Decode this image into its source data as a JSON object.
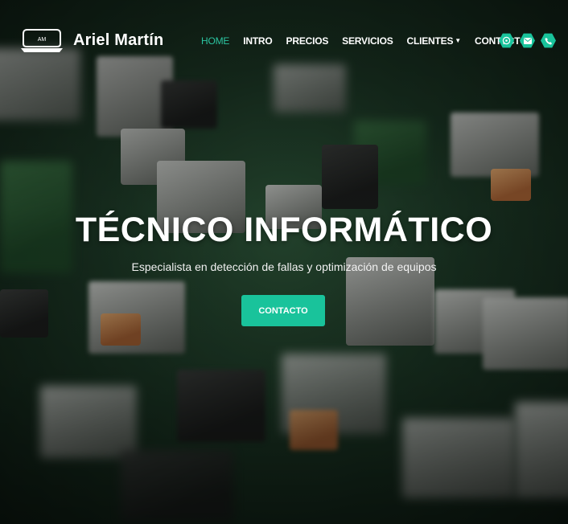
{
  "brand": {
    "logo_text": "AM",
    "name": "Ariel Martín"
  },
  "nav": {
    "items": [
      {
        "label": "HOME",
        "active": true
      },
      {
        "label": "INTRO"
      },
      {
        "label": "PRECIOS"
      },
      {
        "label": "SERVICIOS"
      },
      {
        "label": "CLIENTES",
        "dropdown": true
      },
      {
        "label": "CONTACTO"
      }
    ]
  },
  "social": {
    "icons": [
      "whatsapp-icon",
      "email-icon",
      "phone-icon"
    ],
    "color": "#19c39b"
  },
  "hero": {
    "title": "TÉCNICO INFORMÁTICO",
    "subtitle": "Especialista en detección de fallas y optimización de equipos",
    "cta_label": "CONTACTO"
  },
  "colors": {
    "accent": "#19c39b",
    "active_nav": "#2bc4a0",
    "text": "#ffffff"
  }
}
